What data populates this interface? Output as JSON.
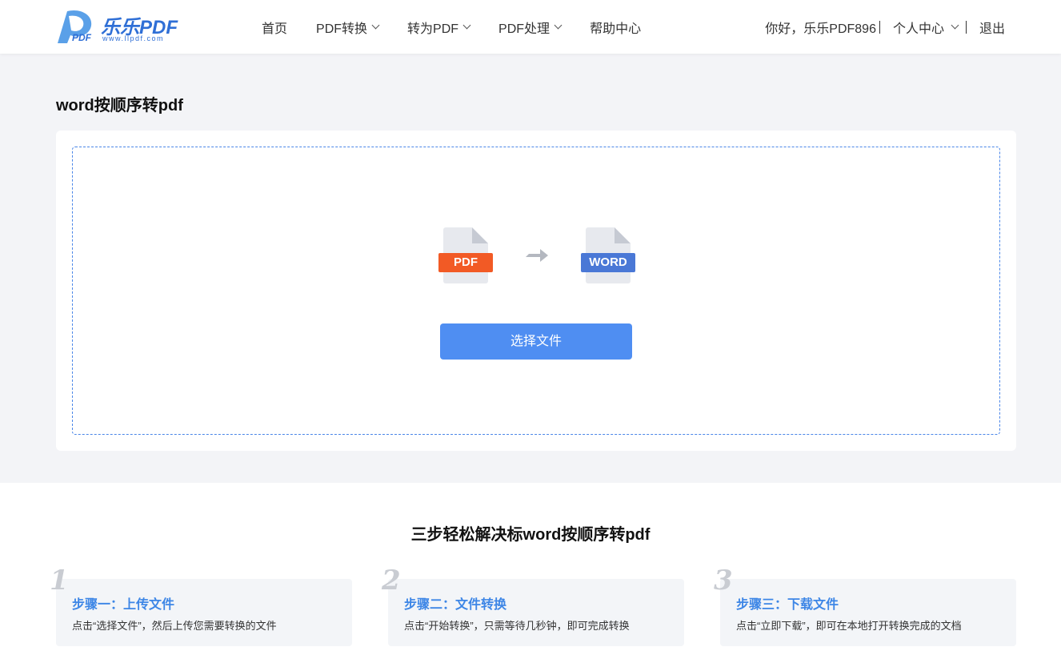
{
  "header": {
    "logo_text": "乐乐PDF",
    "logo_sub": "www.llpdf.com",
    "logo_mark": "PDF",
    "nav": [
      {
        "label": "首页",
        "dropdown": false
      },
      {
        "label": "PDF转换",
        "dropdown": true
      },
      {
        "label": "转为PDF",
        "dropdown": true
      },
      {
        "label": "PDF处理",
        "dropdown": true
      },
      {
        "label": "帮助中心",
        "dropdown": false
      }
    ],
    "greeting": "你好，乐乐PDF896",
    "user_center": "个人中心",
    "logout": "退出"
  },
  "main": {
    "title": "word按顺序转pdf",
    "source_format": "PDF",
    "target_format": "WORD",
    "select_button": "选择文件",
    "icons": [
      "pdf-file-icon",
      "arrow-right-icon",
      "word-file-icon"
    ]
  },
  "steps": {
    "title": "三步轻松解决标word按顺序转pdf",
    "items": [
      {
        "num": "1",
        "head": "步骤一：上传文件",
        "desc": "点击“选择文件”，然后上传您需要转换的文件"
      },
      {
        "num": "2",
        "head": "步骤二：文件转换",
        "desc": "点击“开始转换”，只需等待几秒钟，即可完成转换"
      },
      {
        "num": "3",
        "head": "步骤三：下载文件",
        "desc": "点击“立即下载”，即可在本地打开转换完成的文档"
      }
    ]
  },
  "colors": {
    "brand_blue": "#2f6fd6",
    "button_blue": "#4f8ef2",
    "pdf_orange": "#f25a25",
    "word_blue": "#4a78d6",
    "step_head_blue": "#3d86e6"
  }
}
